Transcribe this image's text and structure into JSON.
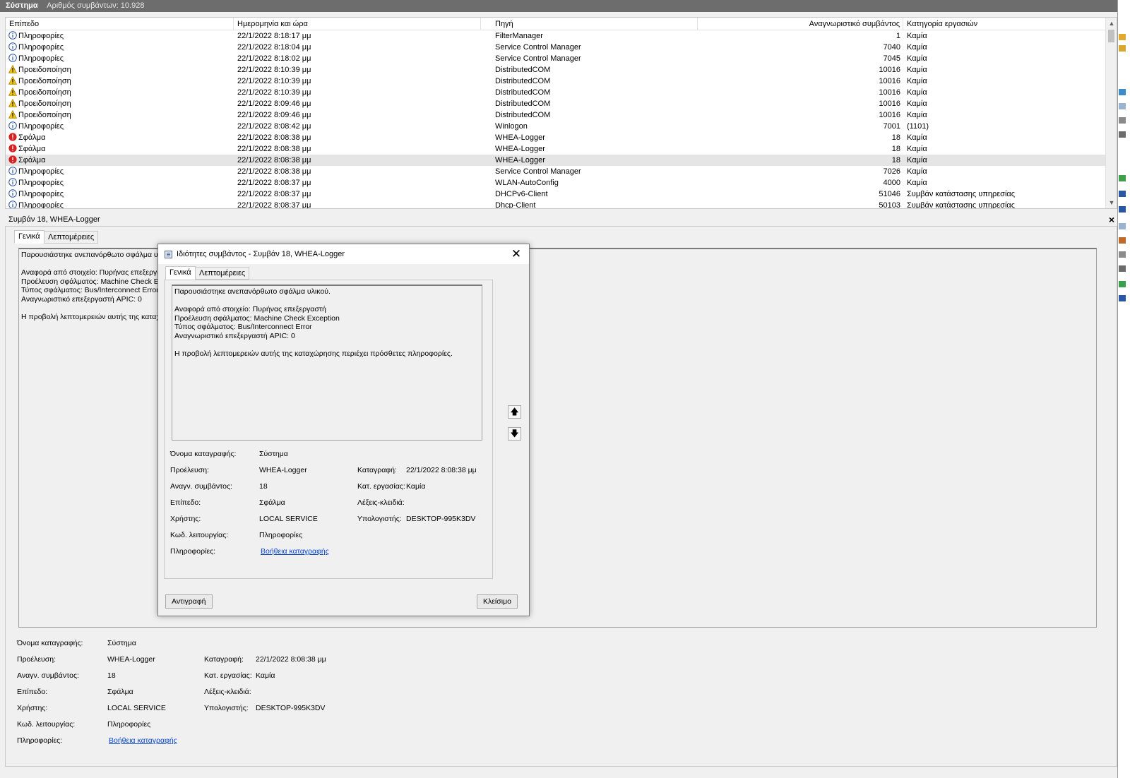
{
  "header": {
    "title": "Σύστημα",
    "count_label": "Αριθμός συμβάντων: 10.928"
  },
  "colors": {
    "info": "#2a56a6",
    "warning": "#f2c200",
    "error": "#d81e1e",
    "link": "#0645d0"
  },
  "list": {
    "columns": [
      "Επίπεδο",
      "Ημερομηνία και ώρα",
      "Πηγή",
      "Αναγνωριστικό συμβάντος",
      "Κατηγορία εργασιών"
    ],
    "rows": [
      {
        "level": "Πληροφορίες",
        "type": "info",
        "date": "22/1/2022 8:18:17 μμ",
        "source": "FilterManager",
        "id": "1",
        "category": "Καμία"
      },
      {
        "level": "Πληροφορίες",
        "type": "info",
        "date": "22/1/2022 8:18:04 μμ",
        "source": "Service Control Manager",
        "id": "7040",
        "category": "Καμία"
      },
      {
        "level": "Πληροφορίες",
        "type": "info",
        "date": "22/1/2022 8:18:02 μμ",
        "source": "Service Control Manager",
        "id": "7045",
        "category": "Καμία"
      },
      {
        "level": "Προειδοποίηση",
        "type": "warning",
        "date": "22/1/2022 8:10:39 μμ",
        "source": "DistributedCOM",
        "id": "10016",
        "category": "Καμία"
      },
      {
        "level": "Προειδοποίηση",
        "type": "warning",
        "date": "22/1/2022 8:10:39 μμ",
        "source": "DistributedCOM",
        "id": "10016",
        "category": "Καμία"
      },
      {
        "level": "Προειδοποίηση",
        "type": "warning",
        "date": "22/1/2022 8:10:39 μμ",
        "source": "DistributedCOM",
        "id": "10016",
        "category": "Καμία"
      },
      {
        "level": "Προειδοποίηση",
        "type": "warning",
        "date": "22/1/2022 8:09:46 μμ",
        "source": "DistributedCOM",
        "id": "10016",
        "category": "Καμία"
      },
      {
        "level": "Προειδοποίηση",
        "type": "warning",
        "date": "22/1/2022 8:09:46 μμ",
        "source": "DistributedCOM",
        "id": "10016",
        "category": "Καμία"
      },
      {
        "level": "Πληροφορίες",
        "type": "info",
        "date": "22/1/2022 8:08:42 μμ",
        "source": "Winlogon",
        "id": "7001",
        "category": "(1101)"
      },
      {
        "level": "Σφάλμα",
        "type": "error",
        "date": "22/1/2022 8:08:38 μμ",
        "source": "WHEA-Logger",
        "id": "18",
        "category": "Καμία"
      },
      {
        "level": "Σφάλμα",
        "type": "error",
        "date": "22/1/2022 8:08:38 μμ",
        "source": "WHEA-Logger",
        "id": "18",
        "category": "Καμία"
      },
      {
        "level": "Σφάλμα",
        "type": "error",
        "date": "22/1/2022 8:08:38 μμ",
        "source": "WHEA-Logger",
        "id": "18",
        "category": "Καμία",
        "selected": true
      },
      {
        "level": "Πληροφορίες",
        "type": "info",
        "date": "22/1/2022 8:08:38 μμ",
        "source": "Service Control Manager",
        "id": "7026",
        "category": "Καμία"
      },
      {
        "level": "Πληροφορίες",
        "type": "info",
        "date": "22/1/2022 8:08:37 μμ",
        "source": "WLAN-AutoConfig",
        "id": "4000",
        "category": "Καμία"
      },
      {
        "level": "Πληροφορίες",
        "type": "info",
        "date": "22/1/2022 8:08:37 μμ",
        "source": "DHCPv6-Client",
        "id": "51046",
        "category": "Συμβάν κατάστασης υπηρεσίας"
      },
      {
        "level": "Πληροφορίες",
        "type": "info",
        "date": "22/1/2022 8:08:37 μμ",
        "source": "Dhcp-Client",
        "id": "50103",
        "category": "Συμβάν κατάστασης υπηρεσίας"
      }
    ]
  },
  "detail": {
    "title": "Συμβάν 18, WHEA-Logger",
    "close": "×",
    "tabs": [
      "Γενικά",
      "Λεπτομέρειες"
    ],
    "description_lines": [
      "Παρουσιάστηκε ανεπανόρθωτο σφάλμα υλ",
      "",
      "Αναφορά από στοιχείο: Πυρήνας επεξεργασ",
      "Προέλευση σφάλματος: Machine Check Exc",
      "Τύπος σφάλματος: Bus/Interconnect Error",
      "Αναγνωριστικό επεξεργαστή APIC: 0",
      "",
      "Η προβολή λεπτομερειών αυτής της καταχ"
    ]
  },
  "props": {
    "log_name_label": "Όνομα καταγραφής:",
    "log_name": "Σύστημα",
    "source_label": "Προέλευση:",
    "source": "WHEA-Logger",
    "logged_label": "Καταγραφή:",
    "logged": "22/1/2022 8:08:38 μμ",
    "event_id_label": "Αναγν. συμβάντος:",
    "event_id": "18",
    "task_label": "Κατ. εργασίας:",
    "task": "Καμία",
    "level_label": "Επίπεδο:",
    "level": "Σφάλμα",
    "keywords_label": "Λέξεις-κλειδιά:",
    "user_label": "Χρήστης:",
    "user": "LOCAL SERVICE",
    "computer_label": "Υπολογιστής:",
    "computer": "DESKTOP-995K3DV",
    "opcode_label": "Κωδ. λειτουργίας:",
    "opcode": "Πληροφορίες",
    "more_info_label": "Πληροφορίες:",
    "more_info_link": "Βοήθεια καταγραφής"
  },
  "dialog": {
    "title": "Ιδιότητες συμβάντος - Συμβάν 18, WHEA-Logger",
    "close": "✕",
    "tabs": [
      "Γενικά",
      "Λεπτομέρειες"
    ],
    "description_lines": [
      "Παρουσιάστηκε ανεπανόρθωτο σφάλμα υλικού.",
      "",
      "Αναφορά από στοιχείο: Πυρήνας επεξεργαστή",
      "Προέλευση σφάλματος: Machine Check Exception",
      "Τύπος σφάλματος: Bus/Interconnect Error",
      "Αναγνωριστικό επεξεργαστή APIC: 0",
      "",
      "Η προβολή λεπτομερειών αυτής της καταχώρησης περιέχει πρόσθετες πληροφορίες."
    ],
    "copy_button": "Αντιγραφή",
    "close_button": "Κλείσιμο"
  }
}
